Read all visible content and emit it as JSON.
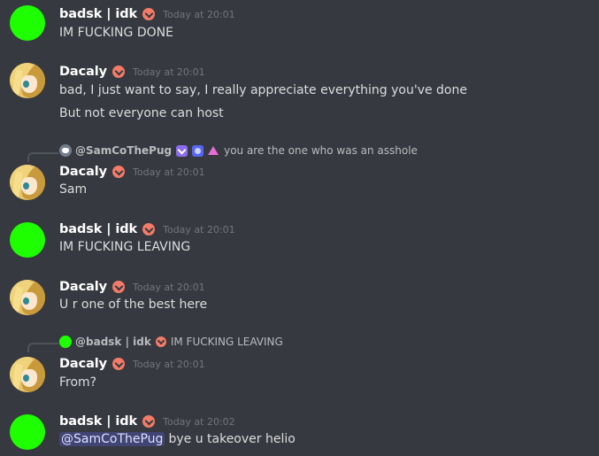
{
  "messages": [
    {
      "user": "badsk | idk",
      "timestamp": "Today at 20:01",
      "text": "IM FUCKING DONE",
      "avatar": "green-avatar"
    },
    {
      "user": "Dacaly",
      "timestamp": "Today at 20:01",
      "lines": [
        "bad, I just want to say, I really appreciate everything you've done",
        "But not everyone can host"
      ],
      "avatar": "anime-avatar"
    },
    {
      "user": "Dacaly",
      "timestamp": "Today at 20:01",
      "text": "Sam",
      "avatar": "anime-avatar",
      "reply": {
        "user": "@SamCoThePug",
        "text": "you are the one who was an asshole",
        "avatar": "discord-default-avatar"
      }
    },
    {
      "user": "badsk | idk",
      "timestamp": "Today at 20:01",
      "text": "IM FUCKING LEAVING",
      "avatar": "green-avatar"
    },
    {
      "user": "Dacaly",
      "timestamp": "Today at 20:01",
      "text": "U r one of the best here",
      "avatar": "anime-avatar"
    },
    {
      "user": "Dacaly",
      "timestamp": "Today at 20:01",
      "text": "From?",
      "avatar": "anime-avatar",
      "reply": {
        "user": "@badsk | idk",
        "text": "IM FUCKING LEAVING",
        "avatar": "green-avatar"
      }
    },
    {
      "user": "badsk | idk",
      "timestamp": "Today at 20:02",
      "mention": "@SamCoThePug",
      "text": "bye u takeover helio",
      "avatar": "green-avatar"
    }
  ],
  "colors": {
    "background": "#36393f",
    "username": "#ffffff",
    "text": "#dcddde",
    "timestamp": "#72767d",
    "badge": "#f47b67",
    "mention_bg": "#5865f2"
  }
}
